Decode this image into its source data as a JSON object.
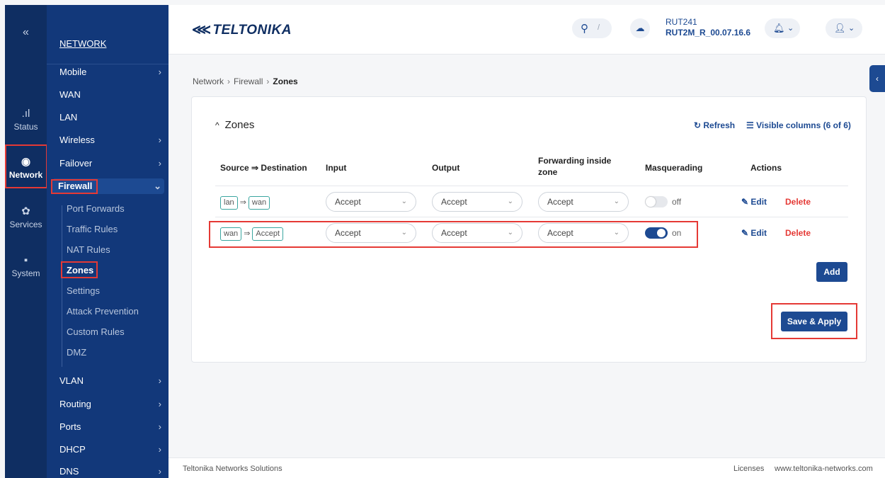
{
  "rail": {
    "collapse": "«",
    "items": [
      {
        "label": "Status",
        "icon": "signal-icon"
      },
      {
        "label": "Network",
        "icon": "globe-icon"
      },
      {
        "label": "Services",
        "icon": "gear-icon"
      },
      {
        "label": "System",
        "icon": "system-icon"
      }
    ]
  },
  "submenu": {
    "title": "NETWORK",
    "items": [
      "Mobile",
      "WAN",
      "LAN",
      "Wireless",
      "Failover",
      "Firewall",
      "VLAN",
      "Routing",
      "Ports",
      "DHCP",
      "DNS"
    ],
    "firewall_items": [
      "Port Forwards",
      "Traffic Rules",
      "NAT Rules",
      "Zones",
      "Settings",
      "Attack Prevention",
      "Custom Rules",
      "DMZ"
    ]
  },
  "header": {
    "logo": "TELTONIKA",
    "search_key": "/",
    "device_model": "RUT241",
    "firmware": "RUT2M_R_00.07.16.6"
  },
  "breadcrumb": {
    "a": "Network",
    "b": "Firewall",
    "c": "Zones"
  },
  "card": {
    "title": "Zones",
    "refresh": "Refresh",
    "visible_columns": "Visible columns (6 of 6)",
    "headers": [
      "Source ⇒ Destination",
      "Input",
      "Output",
      "Forwarding inside zone",
      "Masquerading",
      "Actions"
    ],
    "rows": [
      {
        "source": "lan",
        "dest": "wan",
        "input": "Accept",
        "output": "Accept",
        "forward": "Accept",
        "masq": "off",
        "masq_on": false,
        "edit": "Edit",
        "delete": "Delete"
      },
      {
        "source": "wan",
        "dest": "Accept",
        "input": "Accept",
        "output": "Accept",
        "forward": "Accept",
        "masq": "on",
        "masq_on": true,
        "edit": "Edit",
        "delete": "Delete"
      }
    ],
    "add": "Add",
    "save": "Save & Apply"
  },
  "footer": {
    "company": "Teltonika Networks Solutions",
    "licenses": "Licenses",
    "site": "www.teltonika-networks.com"
  },
  "colors": {
    "primary": "#1d4a92",
    "sidebar": "#0f2e62",
    "danger": "#e53935"
  }
}
